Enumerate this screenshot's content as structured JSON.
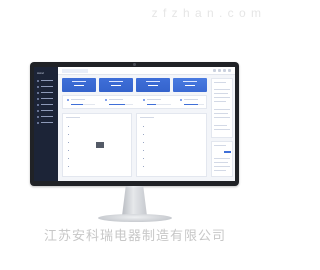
{
  "watermark": "z f z h a n . c o m",
  "caption": "江苏安科瑞电器制造有限公司",
  "app": {
    "logo_text": "Acrel",
    "active_tab_label": "...",
    "nav_count": 8
  },
  "colors": {
    "monitor_bezel": "#202226",
    "sidebar": "#1c2437",
    "accent": "#3f6fd8",
    "screen_bg": "#f3f5f9"
  },
  "icons": {
    "stand": "monitor-stand-icon"
  }
}
